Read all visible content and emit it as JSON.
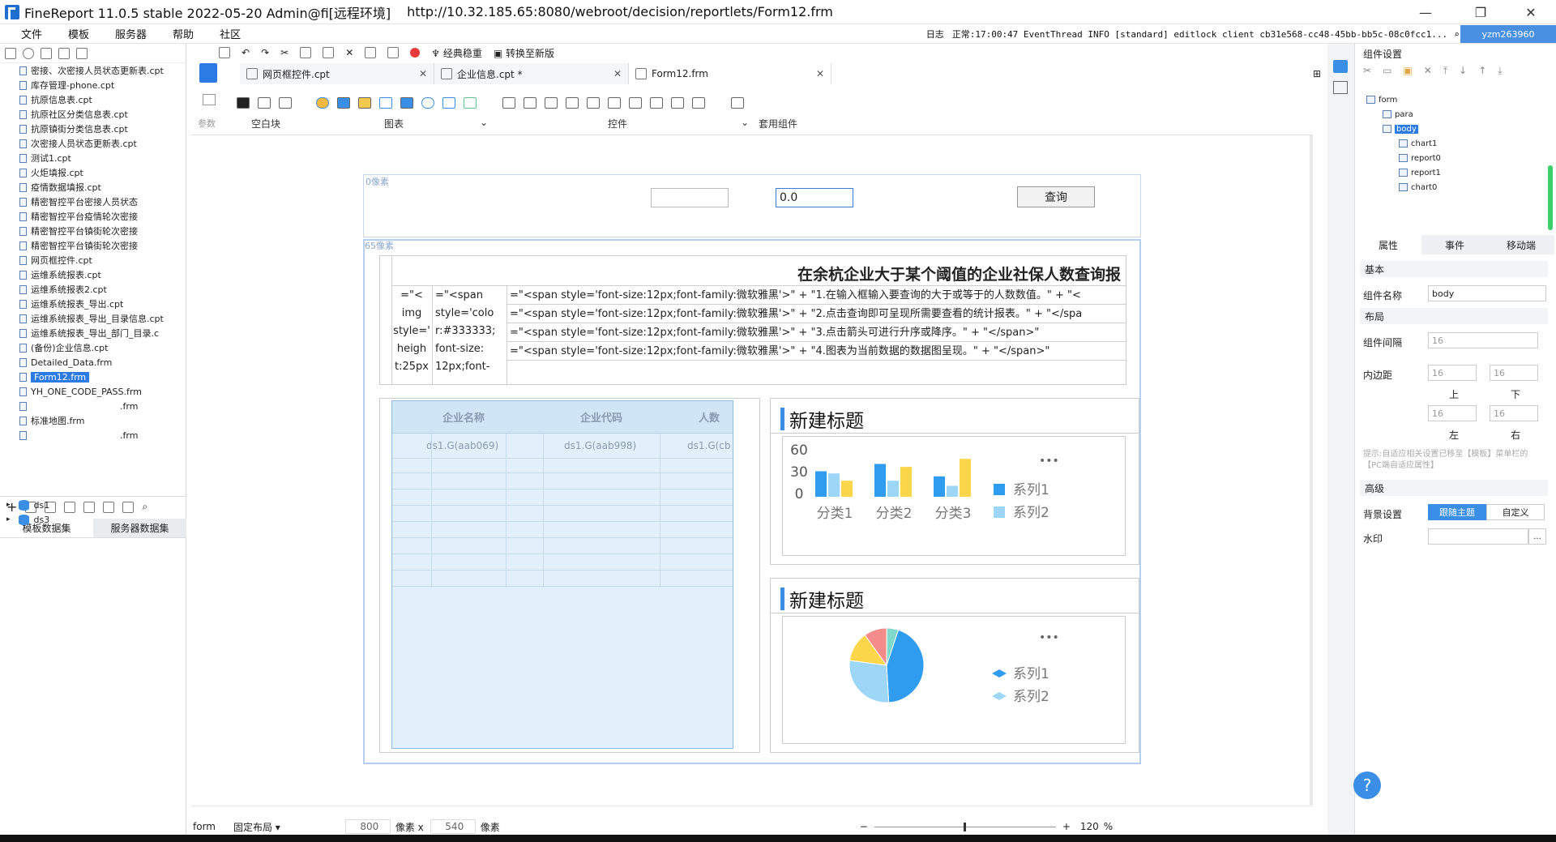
{
  "window": {
    "title": "FineReport 11.0.5 stable 2022-05-20 Admin@fi[远程环境]",
    "url": "http://10.32.185.65:8080/webroot/decision/reportlets/Form12.frm",
    "minimize": "—",
    "maximize": "❐",
    "close": "✕"
  },
  "menu": [
    "文件",
    "模板",
    "服务器",
    "帮助",
    "社区"
  ],
  "status": {
    "log_label": "日志",
    "text": "正常:17:00:47 EventThread INFO [standard] editlock client cb31e568-cc48-45bb-bb5c-08c0fcc1...",
    "user": "yzm263960"
  },
  "left": {
    "files": [
      "密接、次密接人员状态更新表.cpt",
      "库存管理-phone.cpt",
      "抗原信息表.cpt",
      "抗原社区分类信息表.cpt",
      "抗原镇街分类信息表.cpt",
      "次密接人员状态更新表.cpt",
      "测试1.cpt",
      "火炬填报.cpt",
      "疫情数据填报.cpt",
      "精密智控平台密接人员状态",
      "精密智控平台疫情轮次密接",
      "精密智控平台镇街轮次密接",
      "精密智控平台镇街轮次密接",
      "网页框控件.cpt",
      "运维系统报表.cpt",
      "运维系统报表2.cpt",
      "运维系统报表_导出.cpt",
      "运维系统报表_导出_目录信息.cpt",
      "运维系统报表_导出_部门_目录.c",
      "(备份)企业信息.cpt",
      "Detailed_Data.frm",
      "Form12.frm",
      "YH_ONE_CODE_PASS.frm",
      ".frm",
      "标准地图.frm",
      ".frm"
    ],
    "selected_index": 21,
    "ds_tabs": [
      "模板数据集",
      "服务器数据集"
    ],
    "datasets": [
      "ds1",
      "ds3"
    ]
  },
  "toolbar": {
    "classic_stable": "经典稳重",
    "switch_new": "转换至新版",
    "param_label": "参数",
    "groups": [
      "空白块",
      "图表",
      "控件",
      "套用组件"
    ]
  },
  "tabs": [
    {
      "label": "网页框控件.cpt",
      "active": false
    },
    {
      "label": "企业信息.cpt *",
      "active": false
    },
    {
      "label": "Form12.frm",
      "active": true
    }
  ],
  "canvas": {
    "para_px": "0像素",
    "body_px": "65像素",
    "input2_value": "0.0",
    "query_label": "查询",
    "report0": {
      "title": "在余杭企业大于某个阈值的企业社保人数查询报",
      "col1": [
        "=\"<",
        "img",
        "style='",
        "heigh",
        "t:25px"
      ],
      "col2": [
        "=\"<span",
        "style='colo",
        "r:#333333;",
        "font-size:",
        "12px;font-"
      ],
      "lines": [
        "=\"<span style='font-size:12px;font-family:微软雅黑'>\" + \"1.在输入框输入要查询的大于或等于的人数数值。\" + \"<",
        "=\"<span style='font-size:12px;font-family:微软雅黑'>\" + \"2.点击查询即可呈现所需要查看的统计报表。\" + \"</spa",
        "=\"<span style='font-size:12px;font-family:微软雅黑'>\" + \"3.点击箭头可进行升序或降序。\" + \"</span>\"",
        "=\"<span style='font-size:12px;font-family:微软雅黑'>\" + \"4.图表为当前数据的数据图呈现。\" + \"</span>\""
      ]
    },
    "report1": {
      "headers": [
        "企业名称",
        "企业代码",
        "人数"
      ],
      "cells": [
        "ds1.G(aab069)",
        "ds1.G(aab998)",
        "ds1.G(cb"
      ]
    },
    "chart1_title": "新建标题",
    "chart0_title": "新建标题",
    "more": "•••"
  },
  "chart_data": [
    {
      "type": "bar",
      "categories": [
        "分类1",
        "分类2",
        "分类3"
      ],
      "series": [
        {
          "name": "系列1",
          "values": [
            35,
            45,
            28
          ],
          "color": "#2f9cf0"
        },
        {
          "name": "系列2",
          "values": [
            32,
            22,
            15
          ],
          "color": "#9ed6f7"
        },
        {
          "name": "",
          "values": [
            22,
            41,
            52
          ],
          "color": "#fbd54a"
        }
      ],
      "yticks": [
        "60",
        "30",
        "0"
      ],
      "ylim": [
        0,
        60
      ],
      "legend": "right"
    },
    {
      "type": "pie",
      "series": [
        {
          "name": "系列1",
          "value": 44,
          "color": "#2f9cf0"
        },
        {
          "name": "系列2",
          "value": 28,
          "color": "#9ed6f7"
        },
        {
          "name": "",
          "value": 13,
          "color": "#fbd54a"
        },
        {
          "name": "",
          "value": 10,
          "color": "#f58c8c"
        },
        {
          "name": "",
          "value": 5,
          "color": "#7fd8c9"
        }
      ],
      "legend": "right"
    }
  ],
  "right": {
    "title": "组件设置",
    "tree": [
      "form",
      "para",
      "body",
      "chart1",
      "report0",
      "report1",
      "chart0"
    ],
    "prop_tabs": [
      "属性",
      "事件",
      "移动端"
    ],
    "sec_basic": "基本",
    "name_label": "组件名称",
    "name_value": "body",
    "sec_layout": "布局",
    "gap_label": "组件间隔",
    "gap_value": "16",
    "padding_label": "内边距",
    "pad_values": [
      "16",
      "16",
      "16",
      "16"
    ],
    "pad_labels": [
      "上",
      "下",
      "左",
      "右"
    ],
    "hint": "提示:自适应相关设置已移至【模板】菜单栏的【PC端自适应属性】",
    "sec_adv": "高级",
    "bg_label": "背景设置",
    "bg_follow": "跟随主题",
    "bg_custom": "自定义",
    "watermark_label": "水印",
    "watermark_btn": "..."
  },
  "bottom": {
    "form": "form",
    "layout": "固定布局 ▾",
    "width": "800",
    "unit1": "像素 x",
    "height": "540",
    "unit2": "像素",
    "zoom": "120",
    "percent": "%",
    "minus": "−",
    "plus": "+"
  },
  "help": "?"
}
